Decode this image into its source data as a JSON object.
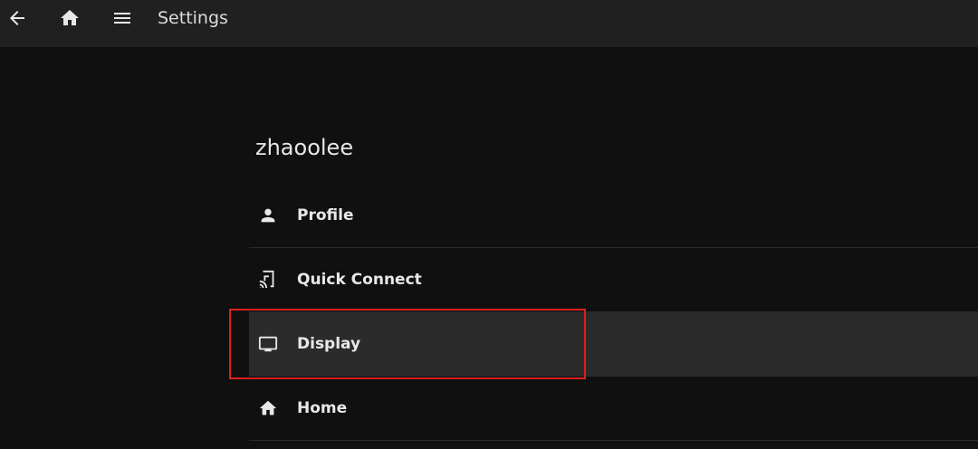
{
  "header": {
    "title": "Settings",
    "icons": {
      "back": "arrow-back-icon",
      "home": "home-icon",
      "menu": "menu-icon"
    }
  },
  "user": {
    "name": "zhaoolee"
  },
  "settings": {
    "items": [
      {
        "label": "Profile",
        "icon": "person-icon"
      },
      {
        "label": "Quick Connect",
        "icon": "phonelink-cast-icon"
      },
      {
        "label": "Display",
        "icon": "monitor-icon",
        "highlighted": true
      },
      {
        "label": "Home",
        "icon": "home-icon"
      }
    ]
  },
  "colors": {
    "background": "#101010",
    "topbar": "#202020",
    "highlight_row": "#2b2b2b",
    "annotation_frame": "#e01e1e"
  }
}
